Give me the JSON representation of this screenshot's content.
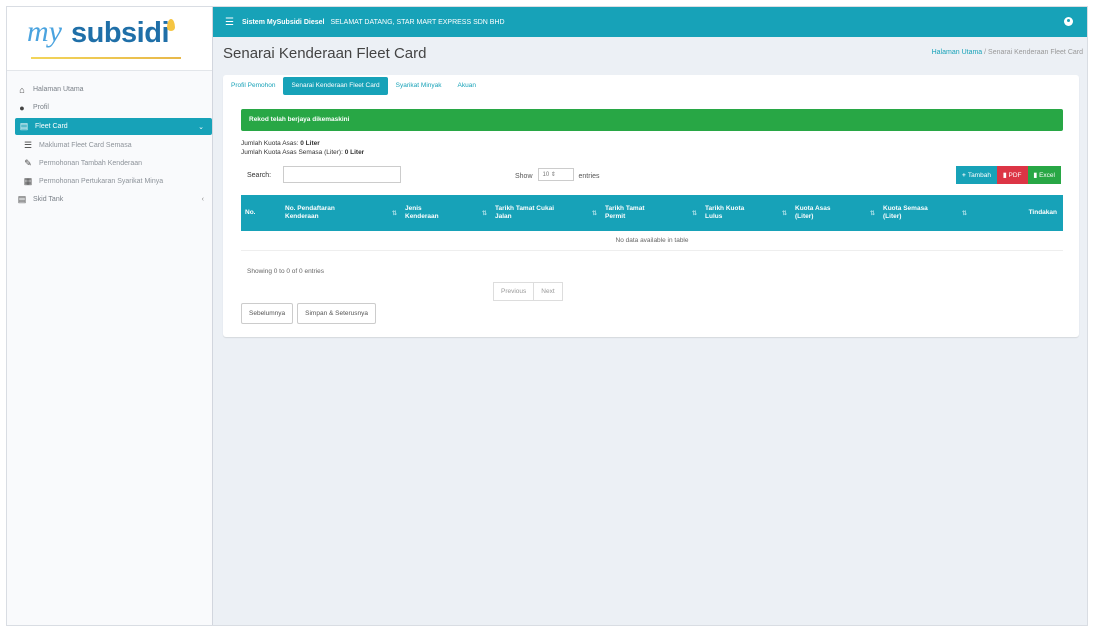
{
  "app": {
    "logo_prefix": "my",
    "logo_main": "subsidi"
  },
  "sidebar": {
    "items": [
      {
        "label": "Halaman Utama",
        "icon": "home-icon"
      },
      {
        "label": "Profil",
        "icon": "user-icon"
      },
      {
        "label": "Fleet Card",
        "icon": "card-icon",
        "active": true
      },
      {
        "label": "Maklumat Fleet Card Semasa",
        "icon": "list-icon"
      },
      {
        "label": "Permohonan Tambah Kenderaan",
        "icon": "edit-icon"
      },
      {
        "label": "Permohonan Pertukaran Syarikat Minya",
        "icon": "fuel-icon"
      },
      {
        "label": "Skid Tank",
        "icon": "tank-icon"
      }
    ]
  },
  "topbar": {
    "system_name": "Sistem MySubsidi Diesel",
    "welcome": "SELAMAT DATANG, STAR MART EXPRESS SDN BHD"
  },
  "header": {
    "title": "Senarai Kenderaan Fleet Card",
    "breadcrumb_home": "Halaman Utama",
    "breadcrumb_sep": "/",
    "breadcrumb_current": "Senarai Kenderaan Fleet Card"
  },
  "tabs": [
    {
      "label": "Profil Pemohon"
    },
    {
      "label": "Senarai Kenderaan Fleet Card",
      "active": true
    },
    {
      "label": "Syarikat Minyak"
    },
    {
      "label": "Akuan"
    }
  ],
  "alert": {
    "text": "Rekod telah berjaya dikemaskini"
  },
  "kuota": {
    "asas_label": "Jumlah Kuota Asas:",
    "asas_value": "0 Liter",
    "semasa_label": "Jumlah Kuota Asas Semasa (Liter):",
    "semasa_value": "0 Liter"
  },
  "table_controls": {
    "search_label": "Search:",
    "search_value": "",
    "show_label": "Show",
    "show_value": "10",
    "entries_label": "entries"
  },
  "actions": {
    "add": "Tambah",
    "pdf": "PDF",
    "excel": "Excel"
  },
  "table": {
    "columns": [
      [
        "No."
      ],
      [
        "No. Pendaftaran",
        "Kenderaan"
      ],
      [
        "Jenis",
        "Kenderaan"
      ],
      [
        "Tarikh Tamat Cukai",
        "Jalan"
      ],
      [
        "Tarikh Tamat",
        "Permit"
      ],
      [
        "Tarikh Kuota",
        "Lulus"
      ],
      [
        "Kuota Asas",
        "(Liter)"
      ],
      [
        "Kuota Semasa",
        "(Liter)"
      ],
      [
        "Tindakan"
      ]
    ],
    "empty_text": "No data available in table"
  },
  "pagination": {
    "info": "Showing 0 to 0 of 0 entries",
    "previous": "Previous",
    "next": "Next"
  },
  "footer": {
    "back": "Sebelumnya",
    "save_next": "Simpan & Seterusnya"
  },
  "colors": {
    "primary": "#17a2b8",
    "success": "#28a745",
    "danger": "#dc3545"
  }
}
